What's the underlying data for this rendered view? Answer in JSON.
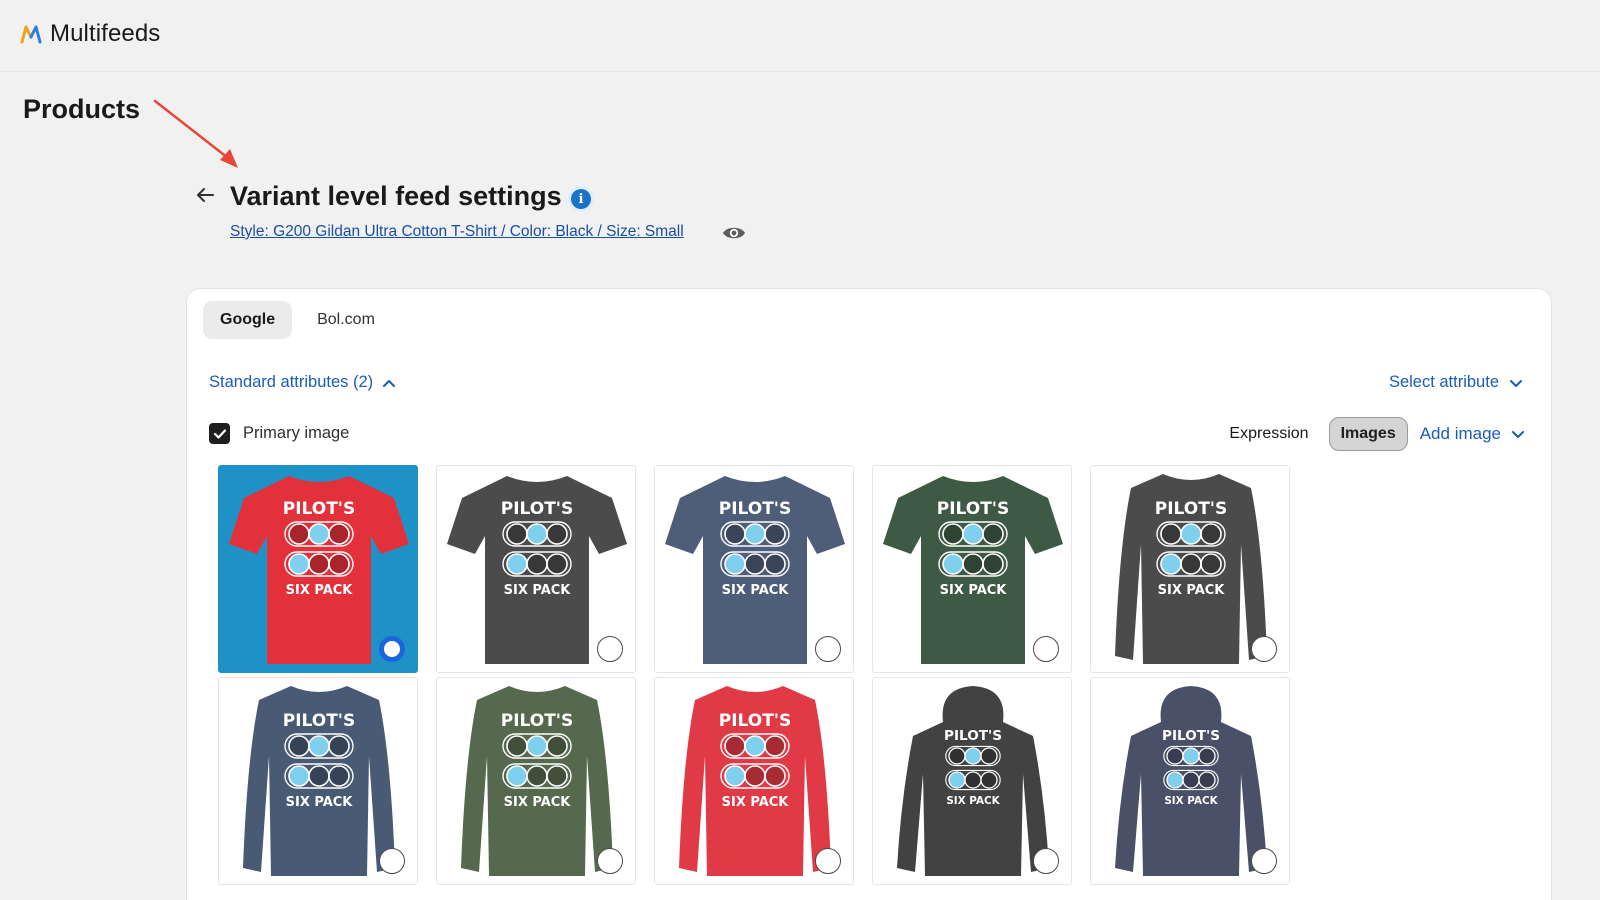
{
  "app": {
    "name": "Multifeeds"
  },
  "page": {
    "title": "Products"
  },
  "section": {
    "title": "Variant level feed settings",
    "variant_link": "Style: G200 Gildan Ultra Cotton T-Shirt / Color: Black / Size: Small",
    "info_label": "i"
  },
  "tabs": [
    {
      "label": "Google",
      "active": true
    },
    {
      "label": "Bol.com",
      "active": false
    }
  ],
  "standard_attributes": {
    "label": "Standard attributes (2)",
    "expanded": true
  },
  "select_attribute": {
    "label": "Select attribute"
  },
  "primary_image": {
    "label": "Primary image",
    "checked": true
  },
  "mode_toggle": {
    "expression_label": "Expression",
    "images_label": "Images",
    "active": "Images"
  },
  "add_image": {
    "label": "Add image"
  },
  "colors": {
    "accent_link": "#1a5db5",
    "selected_tile": "#1e92c6",
    "radio_checked": "#1a66d9",
    "annotation_arrow": "#e8453c"
  },
  "images": [
    {
      "garment": "t-shirt",
      "color": "#e3313b",
      "selected": true
    },
    {
      "garment": "t-shirt",
      "color": "#4b4b4b",
      "selected": false
    },
    {
      "garment": "t-shirt",
      "color": "#4e5d78",
      "selected": false
    },
    {
      "garment": "t-shirt",
      "color": "#3f5a44",
      "selected": false
    },
    {
      "garment": "long-sleeve",
      "color": "#4b4b4b",
      "selected": false
    },
    {
      "garment": "long-sleeve",
      "color": "#495a74",
      "selected": false
    },
    {
      "garment": "long-sleeve",
      "color": "#56694e",
      "selected": false
    },
    {
      "garment": "long-sleeve",
      "color": "#e03a46",
      "selected": false
    },
    {
      "garment": "hoodie",
      "color": "#424242",
      "selected": false
    },
    {
      "garment": "hoodie",
      "color": "#4a5068",
      "selected": false
    }
  ],
  "graphic_text": {
    "top": "PILOT'S",
    "bottom": "SIX PACK"
  }
}
